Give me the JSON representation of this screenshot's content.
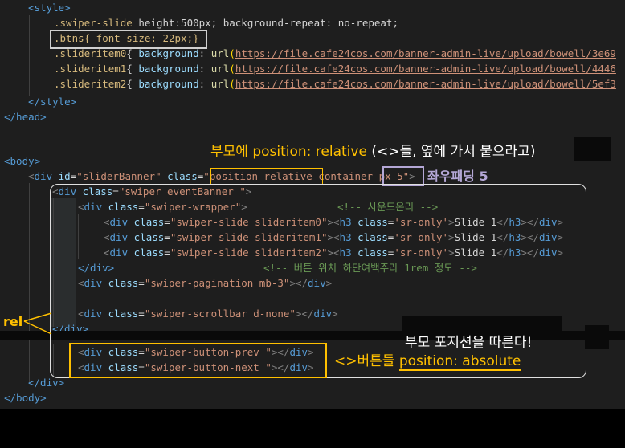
{
  "code": {
    "style_open": "<style>",
    "slide_rule": {
      "selector": ".swiper-slide",
      "decl": " height:500px; background-repeat: no-repeat;"
    },
    "btns_rule": ".btns{ font-size: 22px;}",
    "slider_items": [
      {
        "selector": ".slideritem0",
        "url": "https://file.cafe24cos.com/banner-admin-live/upload/bowell/3e69"
      },
      {
        "selector": ".slideritem1",
        "url": "https://file.cafe24cos.com/banner-admin-live/upload/bowell/4446"
      },
      {
        "selector": ".slideritem2",
        "url": "https://file.cafe24cos.com/banner-admin-live/upload/bowell/5ef3"
      }
    ],
    "bg_prop": "background",
    "url_fn": "url",
    "style_close": "</style>",
    "head_close": "</head>",
    "body_open": "<body>",
    "div_id_value": "\"sliderBanner\"",
    "class_pos": "position-relative",
    "class_container": " container ",
    "class_px": "px-5",
    "swiper_class": "\"swiper eventBanner \"",
    "wrapper_class": "\"swiper-wrapper\"",
    "wrapper_comment": "<!-- 사운드온리 -->",
    "slides": [
      {
        "cls": "\"swiper-slide slideritem0\"",
        "text": "Slide 1"
      },
      {
        "cls": "\"swiper-slide slideritem1\"",
        "text": "Slide 1"
      },
      {
        "cls": "\"swiper-slide slideritem2\"",
        "text": "Slide 1"
      }
    ],
    "sr_only": "'sr-only'",
    "div_close": "</div>",
    "btn_comment": "<!-- 버튼 위치 하단여백주라 1rem 정도 -->",
    "pagination_class": "\"swiper-pagination mb-3\"",
    "scrollbar_class": "\"swiper-scrollbar d-none\"",
    "btn_prev_class": "\"swiper-button-prev \"",
    "btn_next_class": "\"swiper-button-next \"",
    "body_close": "</body>"
  },
  "annotations": {
    "parent_note_a": "부모에 ",
    "parent_note_b": "position: relative",
    "parent_note_c": " (<>들, 옆에 가서 붙으라고)",
    "padding_note": "좌우패딩 5",
    "rel_label": "rel",
    "follow_note": "부모 포지션을 따른다!",
    "buttons_note_a": "<>버튼들 ",
    "buttons_note_b": "position: absolute"
  },
  "colors": {
    "annotation_yellow": "#ffc000",
    "box_gray": "#d0d0d0",
    "box_lavender": "#b4a7d6",
    "box_white": "#e0e0e0"
  }
}
